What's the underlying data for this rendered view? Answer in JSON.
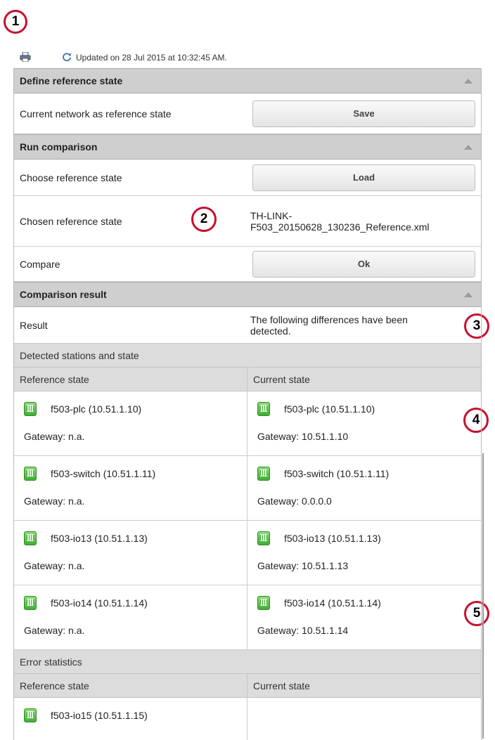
{
  "callouts": [
    "1",
    "2",
    "3",
    "4",
    "5"
  ],
  "toolbar": {
    "print_icon": "printer-icon",
    "refresh_icon": "refresh-icon",
    "updated_text": "Updated on 28 Jul 2015 at 10:32:45 AM."
  },
  "define": {
    "title": "Define reference state",
    "current_label": "Current network as reference state",
    "save_label": "Save"
  },
  "run": {
    "title": "Run comparison",
    "choose_label": "Choose reference state",
    "load_label": "Load",
    "chosen_label": "Chosen reference state",
    "chosen_value": "TH-LINK-\nF503_20150628_130236_Reference.xml",
    "compare_label": "Compare",
    "ok_label": "Ok"
  },
  "result": {
    "title": "Comparison result",
    "result_label": "Result",
    "result_value": "The following differences have been detected.",
    "detected_title": "Detected stations and state",
    "col_reference": "Reference state",
    "col_current": "Current state",
    "stations": [
      {
        "ref_name": "f503-plc (10.51.1.10)",
        "ref_gw": "Gateway: n.a.",
        "cur_name": "f503-plc (10.51.1.10)",
        "cur_gw": "Gateway: 10.51.1.10"
      },
      {
        "ref_name": "f503-switch (10.51.1.11)",
        "ref_gw": "Gateway: n.a.",
        "cur_name": "f503-switch (10.51.1.11)",
        "cur_gw": "Gateway: 0.0.0.0"
      },
      {
        "ref_name": "f503-io13 (10.51.1.13)",
        "ref_gw": "Gateway: n.a.",
        "cur_name": "f503-io13 (10.51.1.13)",
        "cur_gw": "Gateway: 10.51.1.13"
      },
      {
        "ref_name": "f503-io14 (10.51.1.14)",
        "ref_gw": "Gateway: n.a.",
        "cur_name": "f503-io14 (10.51.1.14)",
        "cur_gw": "Gateway: 10.51.1.14"
      }
    ],
    "error_title": "Error statistics",
    "error_col_reference": "Reference state",
    "error_col_current": "Current state",
    "error_station": "f503-io15 (10.51.1.15)"
  }
}
